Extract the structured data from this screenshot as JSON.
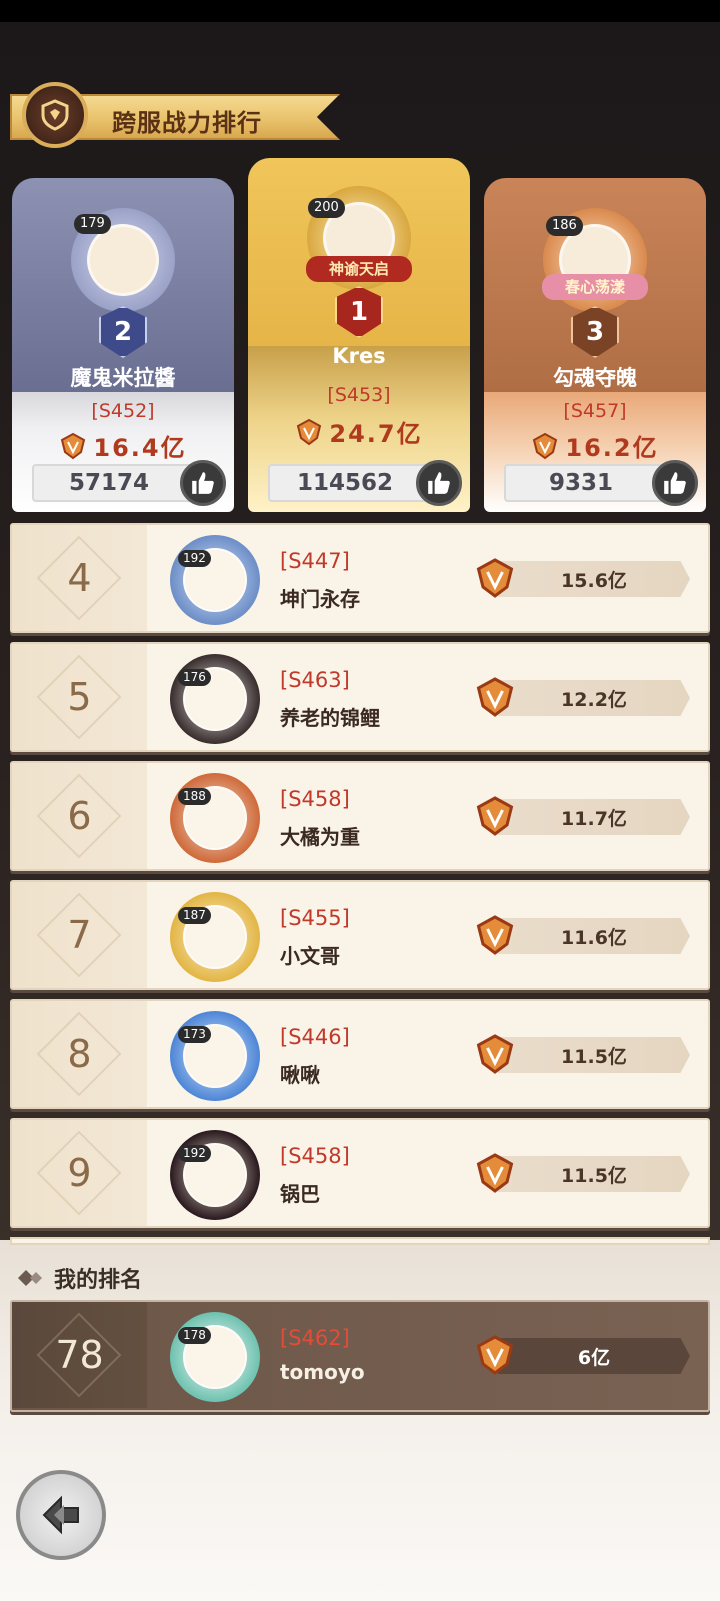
{
  "header": {
    "title": "跨服战力排行"
  },
  "podium": [
    {
      "rank": "2",
      "level": "179",
      "name": "魔鬼米拉醬",
      "server": "[S452]",
      "power": "16.4亿",
      "likes": "57174"
    },
    {
      "rank": "1",
      "level": "200",
      "name": "Kres",
      "server": "[S453]",
      "power": "24.7亿",
      "likes": "114562",
      "frame_label": "神谕天启"
    },
    {
      "rank": "3",
      "level": "186",
      "name": "勾魂夺魄",
      "server": "[S457]",
      "power": "16.2亿",
      "likes": "9331",
      "frame_label": "春心荡漾"
    }
  ],
  "rows": [
    {
      "rank": "4",
      "level": "192",
      "server": "[S447]",
      "name": "坤门永存",
      "power": "15.6亿"
    },
    {
      "rank": "5",
      "level": "176",
      "server": "[S463]",
      "name": "养老的锦鲤",
      "power": "12.2亿"
    },
    {
      "rank": "6",
      "level": "188",
      "server": "[S458]",
      "name": "大橘为重",
      "power": "11.7亿"
    },
    {
      "rank": "7",
      "level": "187",
      "server": "[S455]",
      "name": "小文哥",
      "power": "11.6亿"
    },
    {
      "rank": "8",
      "level": "173",
      "server": "[S446]",
      "name": "啾啾",
      "power": "11.5亿"
    },
    {
      "rank": "9",
      "level": "192",
      "server": "[S458]",
      "name": "锅巴",
      "power": "11.5亿"
    }
  ],
  "my_rank": {
    "title": "我的排名",
    "rank": "78",
    "level": "178",
    "server": "[S462]",
    "name": "tomoyo",
    "power": "6亿"
  },
  "icons": {
    "back": "back-arrow-icon",
    "like": "thumbs-up-icon",
    "power": "power-crest-icon",
    "title": "shield-emblem-icon"
  },
  "colors": {
    "gold": "#e9c26c",
    "silver": "#6c7293",
    "bronze": "#c9865b",
    "server_red": "#c0392b"
  }
}
